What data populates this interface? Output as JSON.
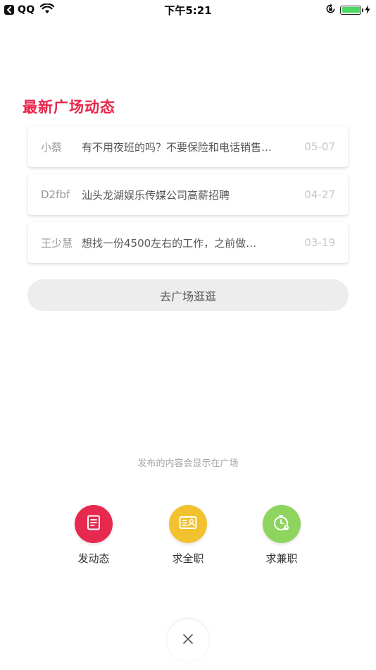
{
  "status_bar": {
    "app": "QQ",
    "time": "下午5:21",
    "battery_level": 1.0
  },
  "section_title": "最新广场动态",
  "feed": [
    {
      "user": "小蔡",
      "message": "有不用夜班的吗？不要保险和电话销售…",
      "date": "05-07"
    },
    {
      "user": "D2fbf",
      "message": "汕头龙湖娱乐传媒公司高薪招聘",
      "date": "04-27"
    },
    {
      "user": "王少慧",
      "message": "想找一份4500左右的工作，之前做…",
      "date": "03-19"
    }
  ],
  "go_square_label": "去广场逛逛",
  "hint": "发布的内容会显示在广场",
  "actions": [
    {
      "label": "发动态",
      "icon": "post-document-icon",
      "color": "#e8294f"
    },
    {
      "label": "求全职",
      "icon": "id-card-icon",
      "color": "#f2c12e"
    },
    {
      "label": "求兼职",
      "icon": "clock-icon",
      "color": "#8fd45e"
    }
  ],
  "close_icon": "close-icon"
}
